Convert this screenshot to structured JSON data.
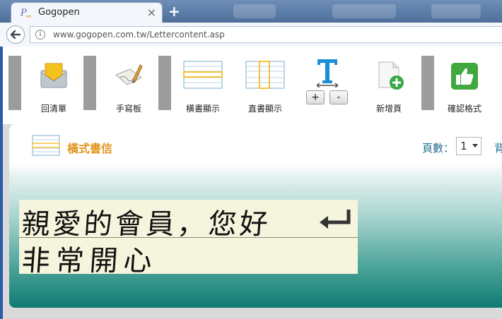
{
  "browser": {
    "tab_title": "Gogopen",
    "tab_close": "×",
    "new_tab": "+",
    "url": "www.gogopen.com.tw/Lettercontent.asp"
  },
  "toolbar": {
    "items": [
      {
        "label": "回清單",
        "icon": "envelope-icon"
      },
      {
        "label": "手寫板",
        "icon": "handwriting-pad-icon"
      },
      {
        "label": "橫書顯示",
        "icon": "horizontal-layout-icon"
      },
      {
        "label": "直書顯示",
        "icon": "vertical-layout-icon"
      },
      {
        "label": "新增頁",
        "icon": "add-page-icon"
      },
      {
        "label": "確認格式",
        "icon": "thumbs-up-icon"
      }
    ],
    "font_size": {
      "increase": "+",
      "decrease": "-",
      "icon": "text-size-icon"
    }
  },
  "content": {
    "heading": "橫式書信",
    "page_label": "頁數：",
    "page_value": "1",
    "bg_label": "背",
    "letter_lines": [
      "親愛的會員，您好",
      "非常開心"
    ]
  },
  "colors": {
    "heading": "#e3951f",
    "page_label": "#1f6e8f",
    "panel_gradient_end": "#0f7a72",
    "separator": "#9c9c9c"
  }
}
